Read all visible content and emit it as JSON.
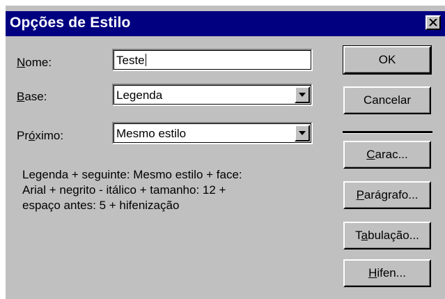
{
  "dialog": {
    "title": "Opções de Estilo",
    "close_label": "×"
  },
  "fields": {
    "nome": {
      "label_first": "N",
      "label_rest": "ome:",
      "value": "Teste"
    },
    "base": {
      "label_first": "B",
      "label_rest": "ase:",
      "value": "Legenda"
    },
    "proximo": {
      "label_pre": "Pr",
      "label_u": "ó",
      "label_post": "ximo:",
      "value": "Mesmo estilo"
    }
  },
  "description": {
    "line1": "Legenda + seguinte: Mesmo estilo + face:",
    "line2": "Arial + negrito - itálico + tamanho: 12 +",
    "line3": "espaço antes: 5 + hifenização"
  },
  "buttons": {
    "ok": "OK",
    "cancel": "Cancelar",
    "carac": {
      "u": "C",
      "rest": "arac..."
    },
    "paragrafo": {
      "u": "P",
      "rest": "arágrafo..."
    },
    "tabulacao": {
      "pre": "T",
      "u": "a",
      "rest": "bulação..."
    },
    "hifen": {
      "u": "H",
      "rest": "ifen..."
    }
  },
  "colors": {
    "titlebar": "#000080",
    "face": "#c0c0c0"
  }
}
